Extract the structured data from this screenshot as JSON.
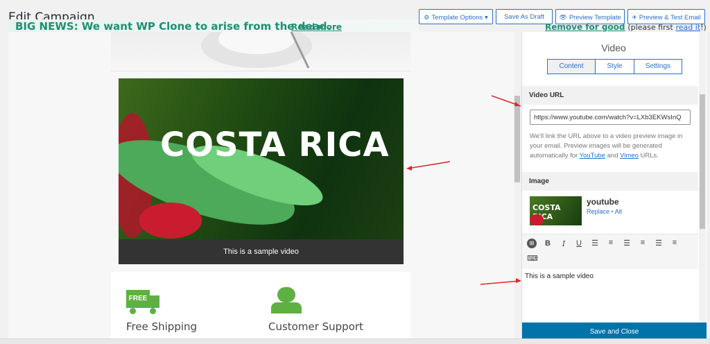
{
  "header": {
    "title": "Edit Campaign",
    "news_text": "BIG NEWS: We want WP Clone to arise from the dead.",
    "news_link": "Read more",
    "template_options": "Template Options",
    "save_draft": "Save As Draft",
    "preview_template": "Preview Template",
    "preview_test": "Preview & Test Email"
  },
  "notice": {
    "link": "Remove for good",
    "text": "(please first",
    "read_it": "read it",
    "end": "!)"
  },
  "canvas": {
    "video_title": "COSTA RICA",
    "video_caption": "This is a sample video",
    "feature1": "Free Shipping",
    "feature2": "Customer Support",
    "free_badge": "FREE"
  },
  "panel": {
    "title": "Video",
    "tabs": [
      "Content",
      "Style",
      "Settings"
    ],
    "video_url_label": "Video URL",
    "video_url_value": "https://www.youtube.com/watch?v=LXb3EKWsInQ",
    "help_text": "We'll link the URL above to a video preview image in your email. Preview images will be generated automatically for",
    "help_link1": "YouTube",
    "help_and": "and",
    "help_link2": "Vimeo",
    "help_end": "URLs.",
    "image_label": "Image",
    "image_name": "youtube",
    "image_replace": "Replace",
    "image_alt": "Alt",
    "image_thumb_text": "COSTA RICA",
    "editor_text": "This is a sample video",
    "save_close": "Save and Close"
  },
  "colors": {
    "accent": "#2a6fc9",
    "news": "#1f8f74",
    "save": "#0073aa"
  }
}
